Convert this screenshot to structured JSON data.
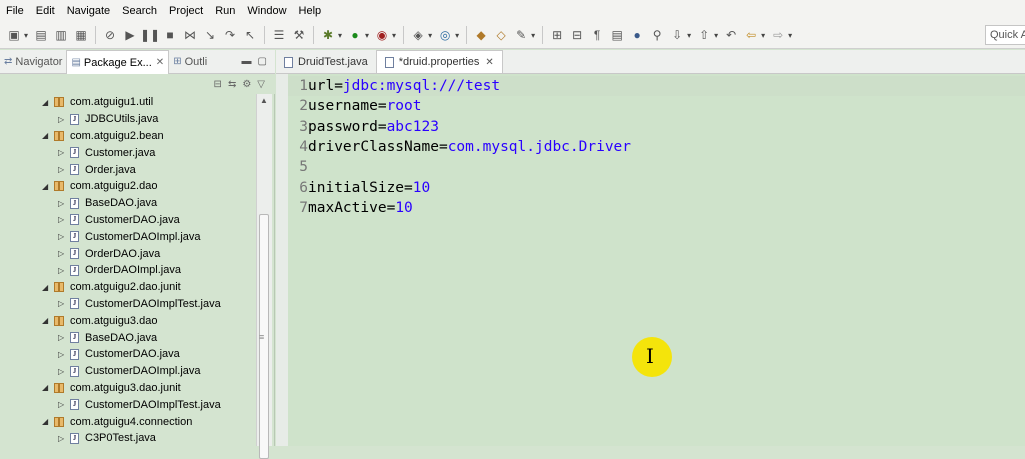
{
  "menu": [
    "File",
    "Edit",
    "Navigate",
    "Search",
    "Project",
    "Run",
    "Window",
    "Help"
  ],
  "toolbar": {
    "quick_access": "Quick Access"
  },
  "left_tabs": {
    "navigator": "Navigator",
    "package_explorer": "Package Ex...",
    "outline": "Outli"
  },
  "tree": [
    {
      "type": "pkg",
      "label": "com.atguigu1.util"
    },
    {
      "type": "file",
      "label": "JDBCUtils.java"
    },
    {
      "type": "pkg",
      "label": "com.atguigu2.bean"
    },
    {
      "type": "file",
      "label": "Customer.java"
    },
    {
      "type": "file",
      "label": "Order.java"
    },
    {
      "type": "pkg",
      "label": "com.atguigu2.dao"
    },
    {
      "type": "file",
      "label": "BaseDAO.java"
    },
    {
      "type": "file",
      "label": "CustomerDAO.java"
    },
    {
      "type": "file",
      "label": "CustomerDAOImpl.java"
    },
    {
      "type": "file",
      "label": "OrderDAO.java"
    },
    {
      "type": "file",
      "label": "OrderDAOImpl.java"
    },
    {
      "type": "pkg",
      "label": "com.atguigu2.dao.junit"
    },
    {
      "type": "file",
      "label": "CustomerDAOImplTest.java"
    },
    {
      "type": "pkg",
      "label": "com.atguigu3.dao"
    },
    {
      "type": "file",
      "label": "BaseDAO.java"
    },
    {
      "type": "file",
      "label": "CustomerDAO.java"
    },
    {
      "type": "file",
      "label": "CustomerDAOImpl.java"
    },
    {
      "type": "pkg",
      "label": "com.atguigu3.dao.junit"
    },
    {
      "type": "file",
      "label": "CustomerDAOImplTest.java"
    },
    {
      "type": "pkg",
      "label": "com.atguigu4.connection"
    },
    {
      "type": "file",
      "label": "C3P0Test.java"
    }
  ],
  "editor_tabs": [
    {
      "label": "DruidTest.java",
      "active": false
    },
    {
      "label": "*druid.properties",
      "active": true
    }
  ],
  "code_lines": [
    {
      "num": "1",
      "key": "url=",
      "value": "jdbc:mysql:///test"
    },
    {
      "num": "2",
      "key": "username=",
      "value": "root"
    },
    {
      "num": "3",
      "key": "password=",
      "value": "abc123"
    },
    {
      "num": "4",
      "key": "driverClassName=",
      "value": "com.mysql.jdbc.Driver"
    },
    {
      "num": "5",
      "key": "",
      "value": ""
    },
    {
      "num": "6",
      "key": "initialSize=",
      "value": "10"
    },
    {
      "num": "7",
      "key": "maxActive=",
      "value": "10"
    }
  ],
  "colors": {
    "editor_bg": "#cfe3cb",
    "value_color": "#2a00ff",
    "cursor_highlight": "#f5e400"
  },
  "cursor": {
    "icon": "text-cursor-icon"
  }
}
